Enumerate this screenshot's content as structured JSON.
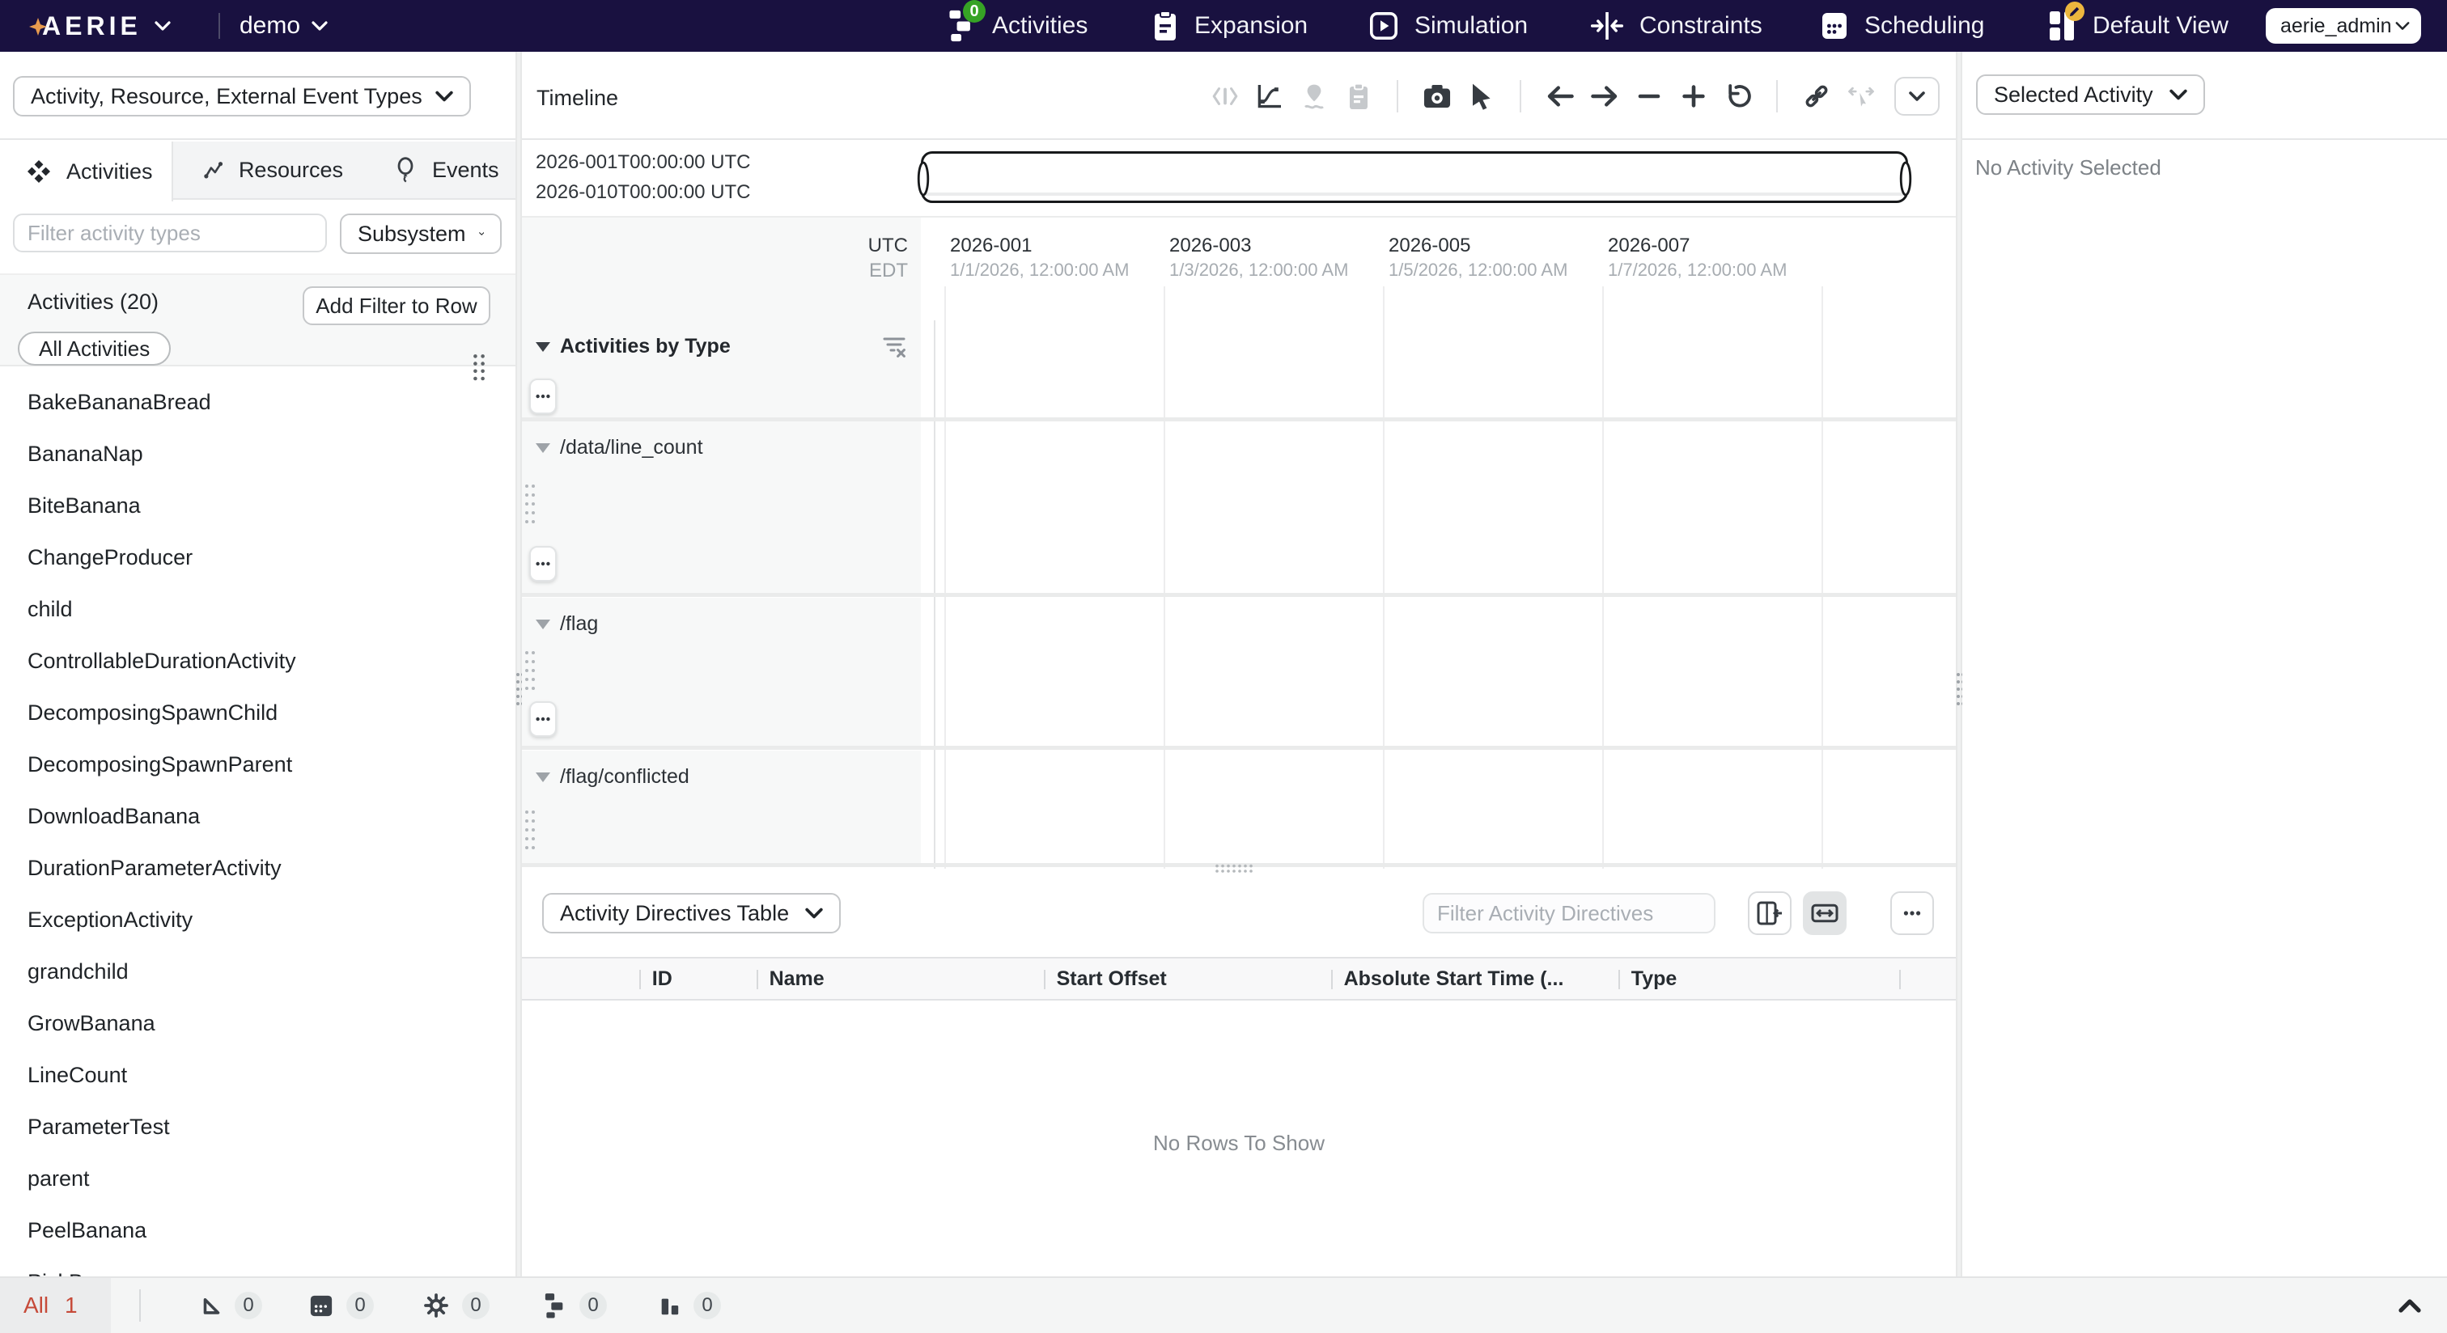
{
  "nav": {
    "logo": "AERIE",
    "plan": "demo",
    "items": [
      {
        "label": "Activities",
        "icon": "activities-icon",
        "badge": "0"
      },
      {
        "label": "Expansion",
        "icon": "expansion-icon"
      },
      {
        "label": "Simulation",
        "icon": "simulation-icon"
      },
      {
        "label": "Constraints",
        "icon": "constraints-icon"
      },
      {
        "label": "Scheduling",
        "icon": "scheduling-icon"
      },
      {
        "label": "Default View",
        "icon": "default-view-icon"
      }
    ],
    "user": "aerie_admin"
  },
  "left": {
    "type_selector": "Activity, Resource, External Event Types",
    "tabs": [
      {
        "label": "Activities",
        "icon": "diamonds-icon"
      },
      {
        "label": "Resources",
        "icon": "resources-icon"
      },
      {
        "label": "Events",
        "icon": "balloon-icon"
      }
    ],
    "filter_placeholder": "Filter activity types",
    "subsystem": "Subsystem",
    "section_title": "Activities (20)",
    "add_filter": "Add Filter to Row",
    "chip": "All Activities",
    "list": [
      "BakeBananaBread",
      "BananaNap",
      "BiteBanana",
      "ChangeProducer",
      "child",
      "ControllableDurationActivity",
      "DecomposingSpawnChild",
      "DecomposingSpawnParent",
      "DownloadBanana",
      "DurationParameterActivity",
      "ExceptionActivity",
      "grandchild",
      "GrowBanana",
      "LineCount",
      "ParameterTest",
      "parent",
      "PeelBanana",
      "PickBanana"
    ]
  },
  "timeline": {
    "title": "Timeline",
    "range_start": "2026-001T00:00:00 UTC",
    "range_end": "2026-010T00:00:00 UTC",
    "tz_primary": "UTC",
    "tz_secondary": "EDT",
    "ticks": [
      {
        "label": "2026-001",
        "sub": "1/1/2026, 12:00:00 AM"
      },
      {
        "label": "2026-003",
        "sub": "1/3/2026, 12:00:00 AM"
      },
      {
        "label": "2026-005",
        "sub": "1/5/2026, 12:00:00 AM"
      },
      {
        "label": "2026-007",
        "sub": "1/7/2026, 12:00:00 AM"
      }
    ],
    "rows": [
      {
        "label": "Activities by Type"
      },
      {
        "label": "/data/line_count"
      },
      {
        "label": "/flag"
      },
      {
        "label": "/flag/conflicted"
      }
    ]
  },
  "table": {
    "selector": "Activity Directives Table",
    "filter_placeholder": "Filter Activity Directives",
    "columns": [
      "ID",
      "Name",
      "Start Offset",
      "Absolute Start Time (...",
      "Type"
    ],
    "empty": "No Rows To Show"
  },
  "right": {
    "selector": "Selected Activity",
    "empty": "No Activity Selected"
  },
  "statusbar": {
    "all_label": "All",
    "all_count": "1",
    "counters": [
      {
        "icon": "triangle-icon",
        "count": "0"
      },
      {
        "icon": "calendar-icon",
        "count": "0"
      },
      {
        "icon": "gear-icon",
        "count": "0"
      },
      {
        "icon": "hierarchy-icon",
        "count": "0"
      },
      {
        "icon": "bar-chart-icon",
        "count": "0"
      }
    ]
  }
}
